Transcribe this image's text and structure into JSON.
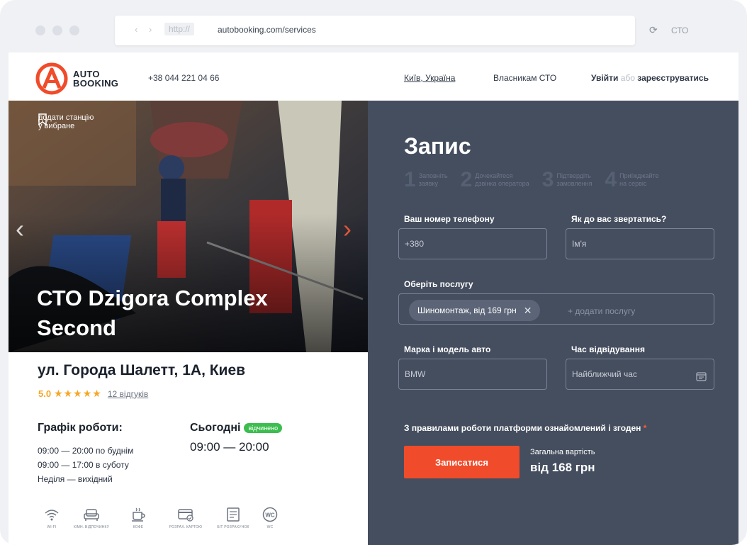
{
  "browser": {
    "nav_arrows": "‹ ›",
    "protocol": "http://",
    "url": "autobooking.com/services",
    "tab_name": "СТО"
  },
  "header": {
    "logo_line1": "AUTO",
    "logo_line2": "BOOKING",
    "phone": "+38 044 221 04 66",
    "city": "Київ, Україна",
    "owners": "Власникам СТО",
    "login": "Увійти",
    "or": "або",
    "register": "зареєструватись"
  },
  "station": {
    "favorite_line1": "додати станцію",
    "favorite_line2": "у вибране",
    "title": "СТО Dzigora Complex Second",
    "address": "ул. Города Шалетт, 1А, Киев",
    "rating": "5.0",
    "reviews": "12 відгуків",
    "schedule_title": "Графік роботи:",
    "schedule": [
      "09:00 — 20:00 по буднім",
      "09:00 — 17:00 в суботу",
      "Неділя — вихідний"
    ],
    "today_title": "Сьогодні",
    "today_badge": "відчинено",
    "today_hours": "09:00 — 20:00",
    "amenities": [
      {
        "icon": "wifi-icon",
        "label": "WI-FI"
      },
      {
        "icon": "sofa-icon",
        "label": "КІМН. ВІДПОЧИНКУ"
      },
      {
        "icon": "coffee-icon",
        "label": "КОФЕ"
      },
      {
        "icon": "card-icon",
        "label": "РОЗРАХ. КАРТОЮ"
      },
      {
        "icon": "receipt-icon",
        "label": "БІТ РОЗРАХУНОК"
      },
      {
        "icon": "wc-icon",
        "label": "WC"
      }
    ]
  },
  "form": {
    "title": "Запис",
    "steps": [
      {
        "num": "1",
        "line1": "Заповніть",
        "line2": "заявку"
      },
      {
        "num": "2",
        "line1": "Дочекайтеся",
        "line2": "дзвінка оператора"
      },
      {
        "num": "3",
        "line1": "Підтвердіть",
        "line2": "замовлення"
      },
      {
        "num": "4",
        "line1": "Приїжджайте",
        "line2": "на сервіс"
      }
    ],
    "phone_label": "Ваш номер телефону",
    "phone_placeholder": "+380",
    "name_label": "Як до вас звертатись?",
    "name_placeholder": "Ім'я",
    "service_label": "Оберіть послугу",
    "service_chip": "Шиномонтаж, від 169 грн",
    "add_service": "+ додати послугу",
    "car_label": "Марка і модель авто",
    "car_value": "BMW",
    "time_label": "Час відвідування",
    "time_placeholder": "Найближчий час",
    "agree_text": "З правилами роботи платформи ознайомлений і згоден",
    "required_mark": "*",
    "submit": "Записатися",
    "total_label": "Загальна вартість",
    "total_value": "від 168 грн"
  },
  "colors": {
    "accent": "#f04b2a",
    "panel": "#454e5f",
    "badge": "#3cbd4f",
    "star": "#f5a623"
  }
}
